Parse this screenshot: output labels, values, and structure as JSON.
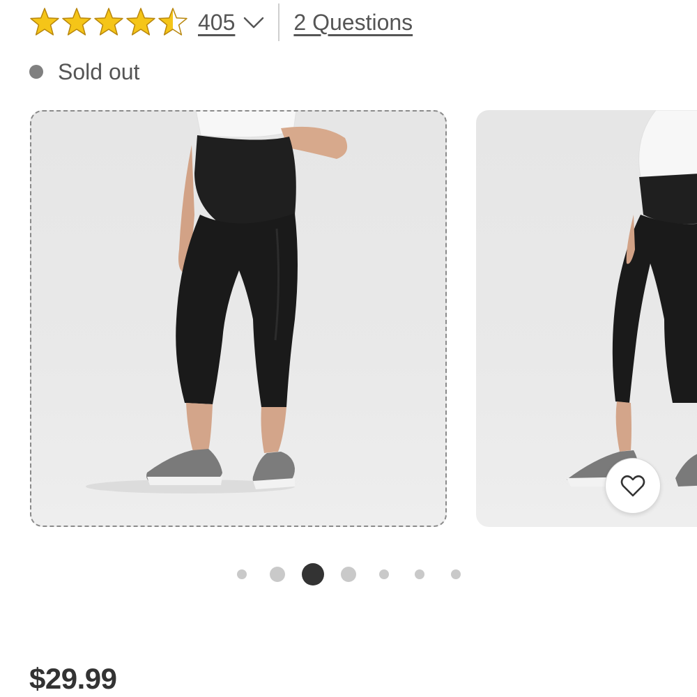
{
  "rating": {
    "value": 4.5,
    "max": 5,
    "review_count": "405",
    "star_color": "#F5C518",
    "star_outline": "#B8860B"
  },
  "questions": {
    "label": "2 Questions"
  },
  "stock": {
    "status": "Sold out",
    "dot_color": "#808080"
  },
  "carousel": {
    "slides": [
      {
        "description": "maternity capri leggings with white top and gray sneakers, front view"
      },
      {
        "description": "maternity capri leggings, side view"
      }
    ],
    "active_index": 2,
    "dot_count": 7,
    "favorite_icon": "heart-outline-icon"
  },
  "price": {
    "value": "$29.99"
  }
}
